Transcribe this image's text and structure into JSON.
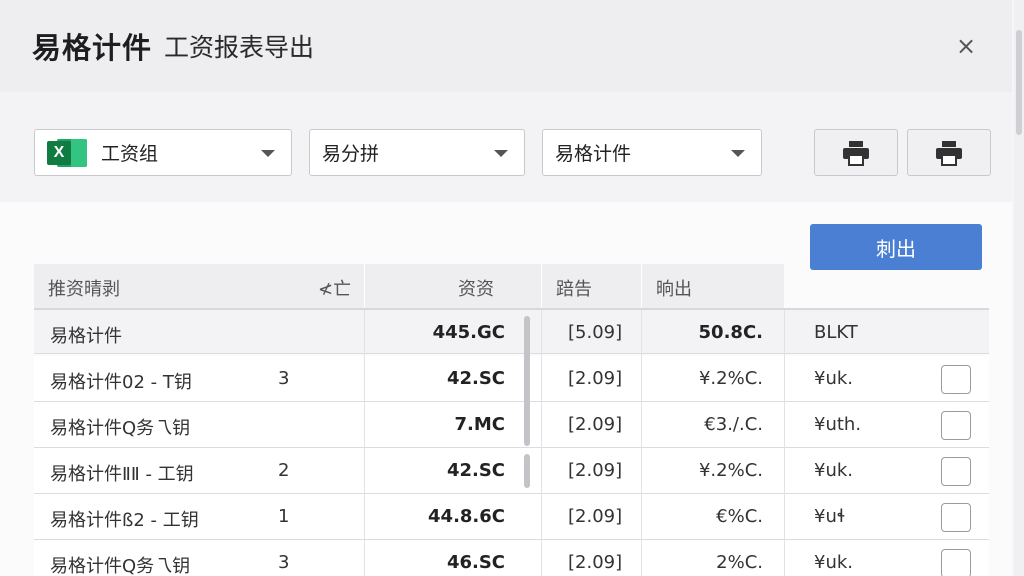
{
  "header": {
    "brand": "易格计件",
    "subtitle": "工资报表导出",
    "close_label": "×"
  },
  "toolbar": {
    "selects": [
      {
        "value": "工资组",
        "icon": "excel-icon",
        "icon_letter": "X"
      },
      {
        "value": "易分拼"
      },
      {
        "value": "易格计件"
      }
    ],
    "print_buttons": [
      "printer-icon",
      "printer-icon"
    ],
    "export_label": "刺出"
  },
  "table": {
    "headers": [
      "推资晴剥",
      "≮亡",
      "资资",
      "踣告",
      "晌出"
    ],
    "total_row": {
      "name": "易格计件",
      "amount": "445.GC",
      "period": "[5.09]",
      "pct": "50.8C.",
      "status": "BLKT"
    },
    "rows": [
      {
        "name": "易格计件02 - T钥",
        "qty": "3",
        "amount": "42.SC",
        "period": "[2.09]",
        "pct": "¥.2%C.",
        "status": "¥uk."
      },
      {
        "name": "易格计件Q务乁钥",
        "qty": "",
        "amount": "7.MC",
        "period": "[2.09]",
        "pct": "€3./.C.",
        "status": "¥uth."
      },
      {
        "name": "易格计件ⅡⅡ - 工钥",
        "qty": "2",
        "amount": "42.SC",
        "period": "[2.09]",
        "pct": "¥.2%C.",
        "status": "¥uk."
      },
      {
        "name": "易格计件ß2 - 工钥",
        "qty": "1",
        "amount": "44.8.6C",
        "period": "[2.09]",
        "pct": "€%C.",
        "status": "¥uɬ"
      },
      {
        "name": "易格计件Q务乁钥",
        "qty": "3",
        "amount": "46.SC",
        "period": "[2.09]",
        "pct": "2%C.",
        "status": "¥uk."
      }
    ]
  },
  "colors": {
    "accent": "#4a7fd3",
    "excel_green": "#107c41"
  }
}
